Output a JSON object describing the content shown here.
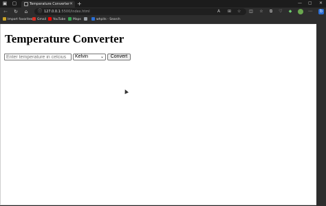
{
  "browser": {
    "tab_title": "Temperature Converter",
    "tab_close": "✕",
    "new_tab": "+",
    "address_host": "127.0.0.1",
    "address_path": ":5500/index.html",
    "favorites": [
      {
        "label": "Import favorites",
        "icon": "folder-icon",
        "color": "#c9a227"
      },
      {
        "label": "Gmail",
        "icon": "gmail-icon",
        "color": "#d93025"
      },
      {
        "label": "YouTube",
        "icon": "youtube-icon",
        "color": "#ff0000"
      },
      {
        "label": "Maps",
        "icon": "maps-icon",
        "color": "#34a853"
      },
      {
        "label": "",
        "icon": "page-icon",
        "color": "#9aa0a6"
      },
      {
        "label": "whpits - Search",
        "icon": "bing-icon",
        "color": "#2b6fd6"
      }
    ]
  },
  "page": {
    "heading": "Temperature Converter",
    "input_placeholder": "Enter temperature in celcius",
    "unit_selected": "Kelvin",
    "convert_label": "Convert"
  },
  "colors": {
    "page_bg": "#ffffff",
    "chrome_bg": "#2d2d2d",
    "tabstrip_bg": "#1c1c1c"
  }
}
